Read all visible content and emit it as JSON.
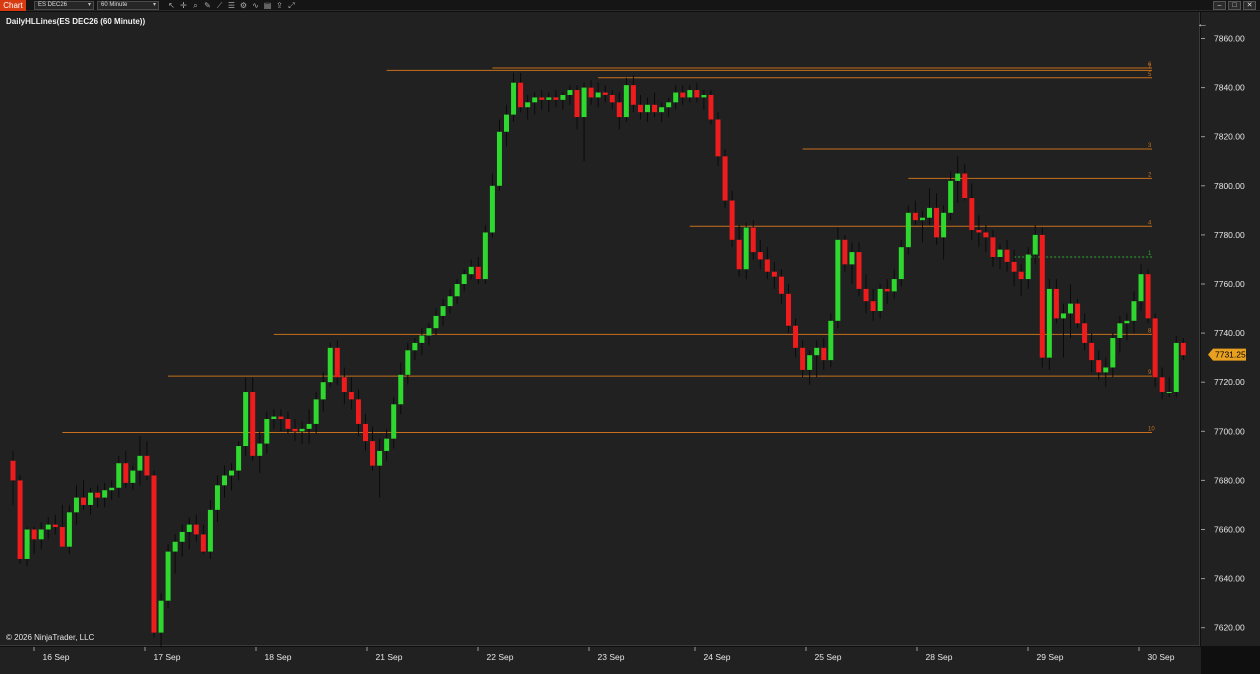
{
  "toolbar": {
    "chart_tab": "Chart",
    "instrument": "ES DEC26",
    "period": "60 Minute",
    "tools": [
      "cursor-icon",
      "crosshair-icon",
      "zoom-icon",
      "draw-icon",
      "line-icon",
      "properties-icon",
      "strategy-icon",
      "indicator-icon",
      "template-icon",
      "share-icon",
      "fullscreen-icon"
    ]
  },
  "window_buttons": [
    "–",
    "□",
    "✕"
  ],
  "indicator_label": "DailyHLLines(ES DEC26 (60 Minute))",
  "copyright": "© 2026 NinjaTrader, LLC",
  "current_price": "7731.25",
  "colors": {
    "up": "#2ed82e",
    "down": "#ee1c1c",
    "level": "#c7701c",
    "level_dotted": "#2ea82e",
    "price_tag": "#e8a020"
  },
  "chart_data": {
    "type": "candlestick",
    "xlabels": [
      "16 Sep",
      "17 Sep",
      "18 Sep",
      "21 Sep",
      "22 Sep",
      "23 Sep",
      "24 Sep",
      "25 Sep",
      "28 Sep",
      "29 Sep",
      "30 Sep"
    ],
    "yticks": [
      "7860.00",
      "7840.00",
      "7820.00",
      "7800.00",
      "7780.00",
      "7760.00",
      "7740.00",
      "7720.00",
      "7700.00",
      "7680.00",
      "7660.00",
      "7640.00",
      "7620.00"
    ],
    "ylim": [
      7614,
      7864
    ],
    "levels": [
      {
        "label": "6",
        "value": 7848,
        "x_start_bar": 68
      },
      {
        "label": "7",
        "value": 7847,
        "x_start_bar": 53
      },
      {
        "label": "5",
        "value": 7844,
        "x_start_bar": 83
      },
      {
        "label": "3",
        "value": 7815,
        "x_start_bar": 112
      },
      {
        "label": "2",
        "value": 7803,
        "x_start_bar": 127
      },
      {
        "label": "4",
        "value": 7783.5,
        "x_start_bar": 96
      },
      {
        "label": "1",
        "value": 7771,
        "x_start_bar": 142,
        "dotted": true
      },
      {
        "label": "8",
        "value": 7739.5,
        "x_start_bar": 37
      },
      {
        "label": "9",
        "value": 7722.5,
        "x_start_bar": 22
      },
      {
        "label": "10",
        "value": 7699.5,
        "x_start_bar": 7
      }
    ],
    "candles": [
      [
        7688,
        7692,
        7670,
        7680
      ],
      [
        7680,
        7682,
        7646,
        7648
      ],
      [
        7648,
        7661,
        7645,
        7660
      ],
      [
        7660,
        7661,
        7650,
        7656
      ],
      [
        7656,
        7663,
        7652,
        7660
      ],
      [
        7660,
        7665,
        7656,
        7662
      ],
      [
        7662,
        7666,
        7658,
        7661
      ],
      [
        7661,
        7670,
        7653,
        7653
      ],
      [
        7653,
        7670,
        7650,
        7667
      ],
      [
        7667,
        7678,
        7662,
        7673
      ],
      [
        7673,
        7680,
        7668,
        7670
      ],
      [
        7670,
        7677,
        7666,
        7675
      ],
      [
        7675,
        7678,
        7669,
        7673
      ],
      [
        7673,
        7679,
        7669,
        7676
      ],
      [
        7676,
        7680,
        7672,
        7677
      ],
      [
        7677,
        7690,
        7673,
        7687
      ],
      [
        7687,
        7692,
        7677,
        7679
      ],
      [
        7679,
        7686,
        7676,
        7684
      ],
      [
        7684,
        7698,
        7678,
        7690
      ],
      [
        7690,
        7696,
        7680,
        7682
      ],
      [
        7682,
        7684,
        7616,
        7618
      ],
      [
        7618,
        7634,
        7612,
        7631
      ],
      [
        7631,
        7654,
        7628,
        7651
      ],
      [
        7651,
        7658,
        7642,
        7655
      ],
      [
        7655,
        7662,
        7649,
        7659
      ],
      [
        7659,
        7665,
        7652,
        7662
      ],
      [
        7662,
        7666,
        7655,
        7658
      ],
      [
        7658,
        7662,
        7650,
        7651
      ],
      [
        7651,
        7672,
        7648,
        7668
      ],
      [
        7668,
        7682,
        7663,
        7678
      ],
      [
        7678,
        7686,
        7673,
        7682
      ],
      [
        7682,
        7687,
        7676,
        7684
      ],
      [
        7684,
        7696,
        7680,
        7694
      ],
      [
        7694,
        7722,
        7690,
        7716
      ],
      [
        7716,
        7722,
        7688,
        7690
      ],
      [
        7690,
        7700,
        7683,
        7695
      ],
      [
        7695,
        7708,
        7691,
        7705
      ],
      [
        7705,
        7709,
        7701,
        7706
      ],
      [
        7706,
        7709,
        7700,
        7705
      ],
      [
        7705,
        7708,
        7699,
        7701
      ],
      [
        7701,
        7705,
        7696,
        7700
      ],
      [
        7700,
        7704,
        7695,
        7701
      ],
      [
        7701,
        7709,
        7695,
        7703
      ],
      [
        7703,
        7716,
        7699,
        7713
      ],
      [
        7713,
        7724,
        7708,
        7720
      ],
      [
        7720,
        7736,
        7718,
        7734
      ],
      [
        7734,
        7737,
        7719,
        7722
      ],
      [
        7722,
        7726,
        7711,
        7716
      ],
      [
        7716,
        7722,
        7709,
        7713
      ],
      [
        7713,
        7717,
        7698,
        7703
      ],
      [
        7703,
        7707,
        7692,
        7696
      ],
      [
        7696,
        7702,
        7684,
        7686
      ],
      [
        7686,
        7697,
        7673,
        7692
      ],
      [
        7692,
        7701,
        7688,
        7697
      ],
      [
        7697,
        7714,
        7693,
        7711
      ],
      [
        7711,
        7728,
        7707,
        7723
      ],
      [
        7723,
        7736,
        7719,
        7733
      ],
      [
        7733,
        7738,
        7729,
        7736
      ],
      [
        7736,
        7742,
        7731,
        7739
      ],
      [
        7739,
        7744,
        7735,
        7742
      ],
      [
        7742,
        7750,
        7739,
        7747
      ],
      [
        7747,
        7754,
        7743,
        7751
      ],
      [
        7751,
        7758,
        7748,
        7755
      ],
      [
        7755,
        7762,
        7752,
        7760
      ],
      [
        7760,
        7766,
        7757,
        7764
      ],
      [
        7764,
        7770,
        7762,
        7767
      ],
      [
        7767,
        7771,
        7760,
        7762
      ],
      [
        7762,
        7784,
        7760,
        7781
      ],
      [
        7781,
        7805,
        7779,
        7800
      ],
      [
        7800,
        7827,
        7798,
        7822
      ],
      [
        7822,
        7833,
        7816,
        7829
      ],
      [
        7829,
        7846,
        7826,
        7842
      ],
      [
        7842,
        7846,
        7830,
        7832
      ],
      [
        7832,
        7837,
        7827,
        7834
      ],
      [
        7834,
        7838,
        7829,
        7836
      ],
      [
        7836,
        7839,
        7831,
        7835
      ],
      [
        7835,
        7838,
        7830,
        7836
      ],
      [
        7836,
        7839,
        7832,
        7835
      ],
      [
        7835,
        7838,
        7831,
        7837
      ],
      [
        7837,
        7841,
        7833,
        7839
      ],
      [
        7839,
        7841,
        7823,
        7828
      ],
      [
        7828,
        7842,
        7810,
        7840
      ],
      [
        7840,
        7843,
        7833,
        7836
      ],
      [
        7836,
        7842,
        7832,
        7838
      ],
      [
        7838,
        7841,
        7834,
        7837
      ],
      [
        7837,
        7839,
        7831,
        7834
      ],
      [
        7834,
        7838,
        7823,
        7828
      ],
      [
        7828,
        7844,
        7826,
        7841
      ],
      [
        7841,
        7845,
        7830,
        7833
      ],
      [
        7833,
        7837,
        7827,
        7830
      ],
      [
        7830,
        7836,
        7826,
        7833
      ],
      [
        7833,
        7838,
        7828,
        7830
      ],
      [
        7830,
        7834,
        7826,
        7832
      ],
      [
        7832,
        7836,
        7828,
        7834
      ],
      [
        7834,
        7841,
        7831,
        7838
      ],
      [
        7838,
        7841,
        7833,
        7836
      ],
      [
        7836,
        7841,
        7834,
        7839
      ],
      [
        7839,
        7842,
        7834,
        7836
      ],
      [
        7836,
        7839,
        7831,
        7837
      ],
      [
        7837,
        7839,
        7825,
        7827
      ],
      [
        7827,
        7830,
        7808,
        7812
      ],
      [
        7812,
        7815,
        7791,
        7794
      ],
      [
        7794,
        7798,
        7775,
        7778
      ],
      [
        7778,
        7784,
        7763,
        7766
      ],
      [
        7766,
        7785,
        7762,
        7783
      ],
      [
        7783,
        7786,
        7770,
        7773
      ],
      [
        7773,
        7778,
        7766,
        7770
      ],
      [
        7770,
        7775,
        7762,
        7765
      ],
      [
        7765,
        7769,
        7758,
        7763
      ],
      [
        7763,
        7766,
        7752,
        7756
      ],
      [
        7756,
        7760,
        7740,
        7743
      ],
      [
        7743,
        7746,
        7730,
        7734
      ],
      [
        7734,
        7737,
        7722,
        7725
      ],
      [
        7725,
        7733,
        7719,
        7731
      ],
      [
        7731,
        7737,
        7722,
        7734
      ],
      [
        7734,
        7738,
        7725,
        7729
      ],
      [
        7729,
        7748,
        7726,
        7745
      ],
      [
        7745,
        7783,
        7742,
        7778
      ],
      [
        7778,
        7780,
        7765,
        7768
      ],
      [
        7768,
        7777,
        7760,
        7773
      ],
      [
        7773,
        7777,
        7755,
        7758
      ],
      [
        7758,
        7764,
        7748,
        7753
      ],
      [
        7753,
        7758,
        7745,
        7749
      ],
      [
        7749,
        7760,
        7746,
        7758
      ],
      [
        7758,
        7762,
        7752,
        7757
      ],
      [
        7757,
        7766,
        7754,
        7762
      ],
      [
        7762,
        7778,
        7759,
        7775
      ],
      [
        7775,
        7792,
        7772,
        7789
      ],
      [
        7789,
        7794,
        7784,
        7786
      ],
      [
        7786,
        7790,
        7777,
        7787
      ],
      [
        7787,
        7799,
        7784,
        7791
      ],
      [
        7791,
        7797,
        7776,
        7779
      ],
      [
        7779,
        7792,
        7770,
        7789
      ],
      [
        7789,
        7806,
        7786,
        7802
      ],
      [
        7802,
        7812,
        7793,
        7805
      ],
      [
        7805,
        7809,
        7794,
        7795
      ],
      [
        7795,
        7801,
        7778,
        7782
      ],
      [
        7782,
        7788,
        7775,
        7781
      ],
      [
        7781,
        7784,
        7773,
        7779
      ],
      [
        7779,
        7782,
        7767,
        7771
      ],
      [
        7771,
        7776,
        7766,
        7774
      ],
      [
        7774,
        7778,
        7765,
        7769
      ],
      [
        7769,
        7774,
        7759,
        7765
      ],
      [
        7765,
        7768,
        7755,
        7762
      ],
      [
        7762,
        7775,
        7758,
        7772
      ],
      [
        7772,
        7784,
        7768,
        7780
      ],
      [
        7780,
        7783,
        7726,
        7730
      ],
      [
        7730,
        7762,
        7725,
        7758
      ],
      [
        7758,
        7762,
        7744,
        7746
      ],
      [
        7746,
        7752,
        7730,
        7748
      ],
      [
        7748,
        7760,
        7738,
        7752
      ],
      [
        7752,
        7754,
        7742,
        7744
      ],
      [
        7744,
        7748,
        7733,
        7736
      ],
      [
        7736,
        7740,
        7724,
        7729
      ],
      [
        7729,
        7733,
        7721,
        7724
      ],
      [
        7724,
        7730,
        7718,
        7726
      ],
      [
        7726,
        7740,
        7722,
        7738
      ],
      [
        7738,
        7747,
        7732,
        7744
      ],
      [
        7744,
        7748,
        7737,
        7745
      ],
      [
        7745,
        7757,
        7740,
        7753
      ],
      [
        7753,
        7768,
        7749,
        7764
      ],
      [
        7764,
        7766,
        7744,
        7746
      ],
      [
        7746,
        7748,
        7718,
        7722
      ],
      [
        7722,
        7726,
        7713,
        7716
      ],
      [
        7716,
        7722,
        7714,
        7716
      ],
      [
        7716,
        7739,
        7714,
        7736
      ],
      [
        7736,
        7738,
        7729,
        7731
      ]
    ]
  }
}
